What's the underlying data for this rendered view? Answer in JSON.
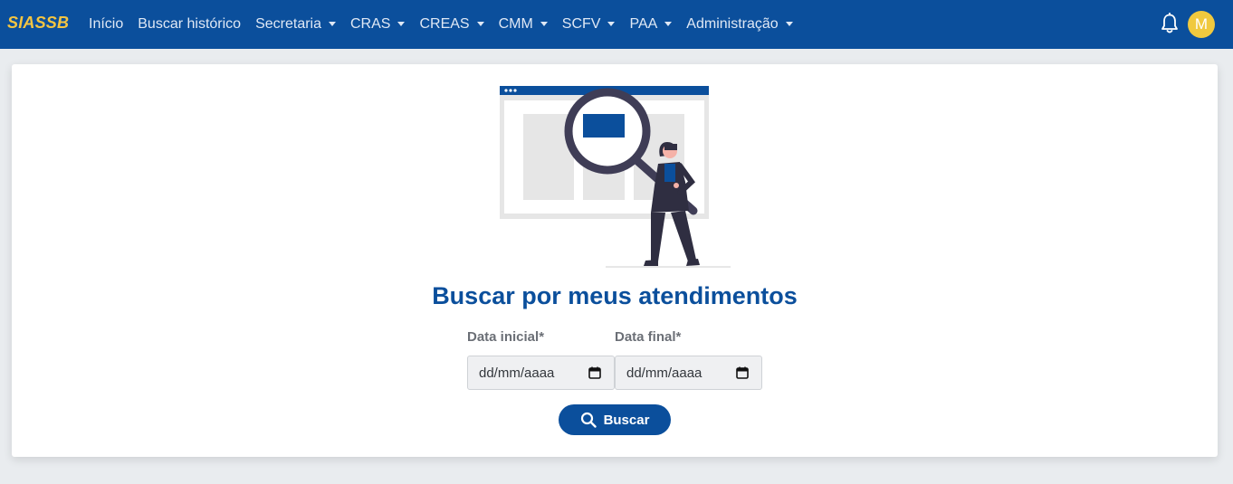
{
  "brand": "SIASSB",
  "nav": [
    {
      "label": "Início",
      "dropdown": false
    },
    {
      "label": "Buscar histórico",
      "dropdown": false
    },
    {
      "label": "Secretaria",
      "dropdown": true
    },
    {
      "label": "CRAS",
      "dropdown": true
    },
    {
      "label": "CREAS",
      "dropdown": true
    },
    {
      "label": "CMM",
      "dropdown": true
    },
    {
      "label": "SCFV",
      "dropdown": true
    },
    {
      "label": "PAA",
      "dropdown": true
    },
    {
      "label": "Administração",
      "dropdown": true
    }
  ],
  "user": {
    "initial": "M",
    "avatar_color": "#f0c93e"
  },
  "colors": {
    "primary": "#0b4f9c",
    "brand": "#f4c542"
  },
  "page": {
    "title": "Buscar por meus atendimentos",
    "start_label": "Data inicial*",
    "end_label": "Data final*",
    "start_placeholder": "dd/mm/aaaa",
    "end_placeholder": "dd/mm/aaaa",
    "search_button": "Buscar"
  },
  "icons": {
    "notifications": "bell-icon",
    "calendar": "calendar-icon",
    "search": "search-icon"
  }
}
